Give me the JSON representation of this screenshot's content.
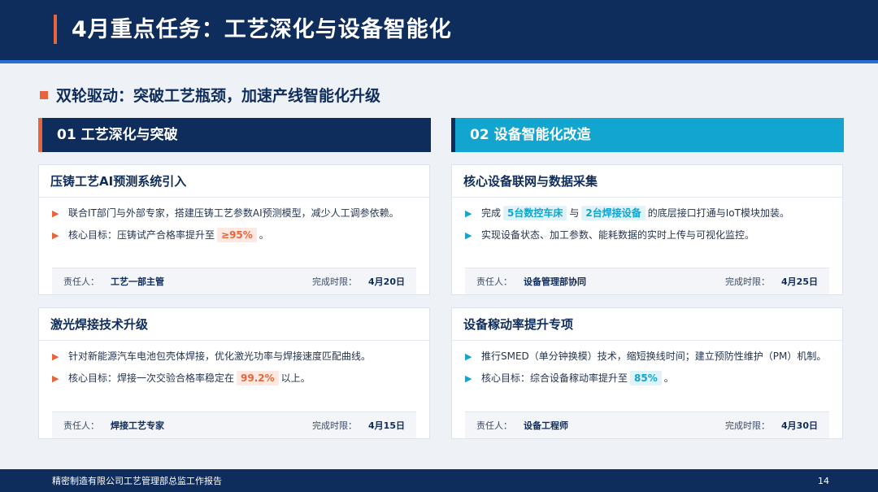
{
  "header": {
    "title": "4月重点任务：工艺深化与设备智能化"
  },
  "subtitle": "双轮驱动：突破工艺瓶颈，加速产线智能化升级",
  "columns": {
    "left": {
      "label": "01 工艺深化与突破"
    },
    "right": {
      "label": "02 设备智能化改造"
    }
  },
  "labels": {
    "owner": "责任人：",
    "deadline": "完成时限："
  },
  "cards": [
    {
      "title": "压铸工艺AI预测系统引入",
      "b1": "联合IT部门与外部专家，搭建压铸工艺参数AI预测模型，减少人工调参依赖。",
      "b2_pre": "核心目标：压铸试产合格率提升至",
      "b2_hl": "≥95%",
      "b2_post": "。",
      "owner": "工艺一部主管",
      "deadline": "4月20日"
    },
    {
      "title": "激光焊接技术升级",
      "b1": "针对新能源汽车电池包壳体焊接，优化激光功率与焊接速度匹配曲线。",
      "b2_pre": "核心目标：焊接一次交验合格率稳定在",
      "b2_hl": "99.2%",
      "b2_post": "以上。",
      "owner": "焊接工艺专家",
      "deadline": "4月15日"
    },
    {
      "title": "核心设备联网与数据采集",
      "b1_pre": "完成",
      "b1_hl1": "5台数控车床",
      "b1_mid": "与",
      "b1_hl2": "2台焊接设备",
      "b1_post": "的底层接口打通与IoT模块加装。",
      "b2": "实现设备状态、加工参数、能耗数据的实时上传与可视化监控。",
      "owner": "设备管理部协同",
      "deadline": "4月25日"
    },
    {
      "title": "设备稼动率提升专项",
      "b1": "推行SMED（单分钟换模）技术，缩短换线时间；建立预防性维护（PM）机制。",
      "b2_pre": "核心目标：综合设备稼动率提升至",
      "b2_hl": "85%",
      "b2_post": "。",
      "owner": "设备工程师",
      "deadline": "4月30日"
    }
  ],
  "footer": {
    "company": "精密制造有限公司工艺管理部总监工作报告",
    "page": "14"
  },
  "colors": {
    "navy": "#0f2d5c",
    "orange": "#e8643c",
    "cyan": "#12a5cf"
  }
}
